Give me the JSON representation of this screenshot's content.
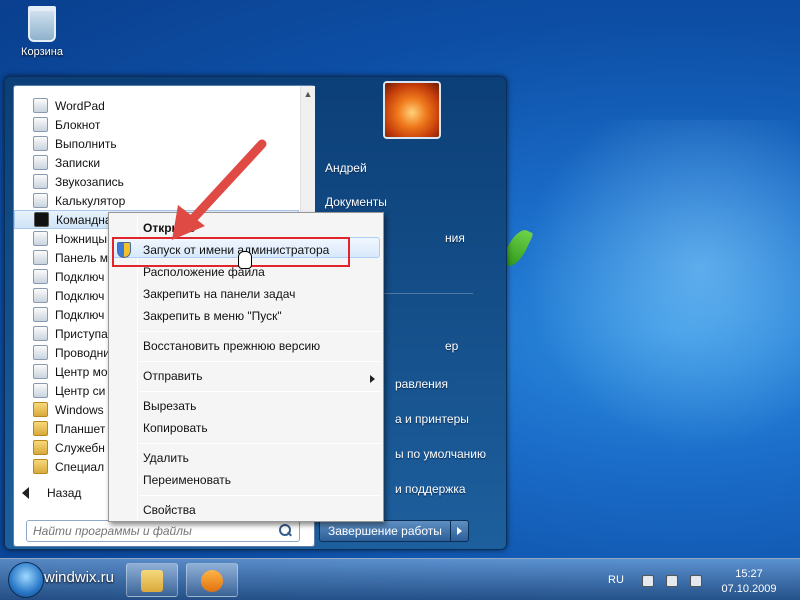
{
  "desktop": {
    "recycle_bin": "Корзина"
  },
  "start_menu": {
    "programs": [
      {
        "label": "WordPad",
        "icon": "wordpad-icon"
      },
      {
        "label": "Блокнот",
        "icon": "notepad-icon"
      },
      {
        "label": "Выполнить",
        "icon": "run-icon"
      },
      {
        "label": "Записки",
        "icon": "sticky-notes-icon"
      },
      {
        "label": "Звукозапись",
        "icon": "sound-recorder-icon"
      },
      {
        "label": "Калькулятор",
        "icon": "calculator-icon"
      },
      {
        "label": "Командная строка",
        "icon": "command-prompt-icon"
      },
      {
        "label": "Ножницы",
        "icon": "snipping-tool-icon"
      },
      {
        "label": "Панель м",
        "icon": "math-panel-icon"
      },
      {
        "label": "Подключ",
        "icon": "connect-icon"
      },
      {
        "label": "Подключ",
        "icon": "connect-icon"
      },
      {
        "label": "Подключ",
        "icon": "connect-icon"
      },
      {
        "label": "Приступа",
        "icon": "getting-started-icon"
      },
      {
        "label": "Проводни",
        "icon": "explorer-icon"
      },
      {
        "label": "Центр мо",
        "icon": "mobility-center-icon"
      },
      {
        "label": "Центр си",
        "icon": "sync-center-icon"
      },
      {
        "label": "Windows I",
        "icon": "folder-icon"
      },
      {
        "label": "Планшет",
        "icon": "folder-icon"
      },
      {
        "label": "Служебн",
        "icon": "folder-icon"
      },
      {
        "label": "Специал",
        "icon": "folder-icon"
      }
    ],
    "back_label": "Назад",
    "search_placeholder": "Найти программы и файлы",
    "right_items": [
      {
        "label": "Андрей"
      },
      {
        "label": "Документы"
      },
      {
        "label": "ния"
      },
      {
        "label": "ер"
      },
      {
        "label": "равления"
      },
      {
        "label": "а и принтеры"
      },
      {
        "label": "ы по умолчанию"
      },
      {
        "label": "и поддержка"
      }
    ],
    "shutdown_label": "Завершение работы"
  },
  "context_menu": {
    "items": [
      {
        "label": "Открыть",
        "bold": true
      },
      {
        "label": "Запуск от имени администратора",
        "highlighted": true
      },
      {
        "label": "Расположение файла"
      },
      {
        "label": "Закрепить на панели задач"
      },
      {
        "label": "Закрепить в меню \"Пуск\""
      },
      {
        "label": "Восстановить прежнюю версию"
      },
      {
        "label": "Отправить",
        "submenu": true
      },
      {
        "label": "Вырезать"
      },
      {
        "label": "Копировать"
      },
      {
        "label": "Удалить"
      },
      {
        "label": "Переименовать"
      },
      {
        "label": "Свойства"
      }
    ]
  },
  "taskbar": {
    "watermark": "windwix.ru",
    "language": "RU",
    "time": "15:27",
    "date": "07.10.2009"
  },
  "colors": {
    "highlight_box": "#e0262b",
    "pointer_arrow": "#e04a45"
  }
}
